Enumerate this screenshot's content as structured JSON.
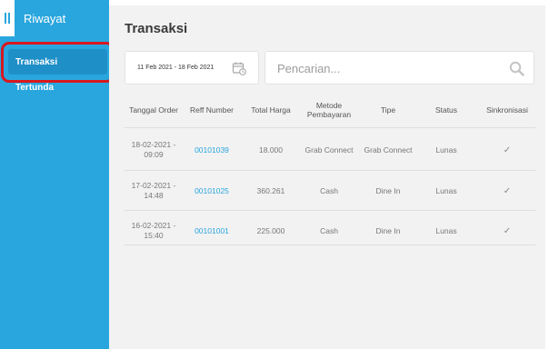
{
  "sidebar": {
    "title": "Riwayat",
    "items": [
      {
        "label": "Transaksi",
        "active": true
      },
      {
        "label": "Tertunda",
        "active": false
      }
    ]
  },
  "main": {
    "title": "Transaksi",
    "date_range": "11 Feb 2021 - 18 Feb 2021",
    "search_placeholder": "Pencarian..."
  },
  "table": {
    "headers": {
      "tanggal": "Tanggal Order",
      "reff": "Reff Number",
      "total": "Total Harga",
      "metode": "Metode Pembayaran",
      "tipe": "Tipe",
      "status": "Status",
      "sinkron": "Sinkronisasi"
    },
    "rows": [
      {
        "tanggal": "18-02-2021 - 09:09",
        "reff": "00101039",
        "total": "18.000",
        "metode": "Grab Connect",
        "tipe": "Grab Connect",
        "status": "Lunas",
        "sinkron": "✓"
      },
      {
        "tanggal": "17-02-2021 - 14:48",
        "reff": "00101025",
        "total": "360.261",
        "metode": "Cash",
        "tipe": "Dine In",
        "status": "Lunas",
        "sinkron": "✓"
      },
      {
        "tanggal": "16-02-2021 - 15:40",
        "reff": "00101001",
        "total": "225.000",
        "metode": "Cash",
        "tipe": "Dine In",
        "status": "Lunas",
        "sinkron": "✓"
      }
    ]
  },
  "colors": {
    "sidebar": "#2aa6de",
    "active_item": "#1f8fc7",
    "link": "#2aa6de",
    "highlight": "#d8181f",
    "main_bg": "#f2f2f2"
  }
}
